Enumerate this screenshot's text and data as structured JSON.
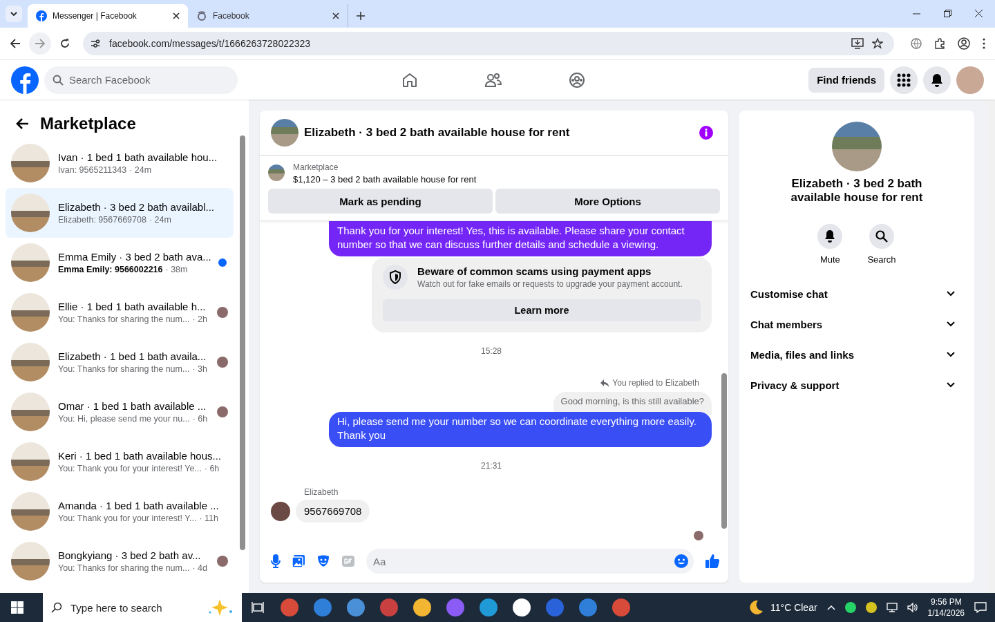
{
  "browser": {
    "tabs": [
      {
        "title": "Messenger | Facebook",
        "selected": true,
        "kind": "facebook"
      },
      {
        "title": "Facebook",
        "selected": false,
        "kind": "other"
      }
    ],
    "url": "facebook.com/messages/t/1666263728022323"
  },
  "header": {
    "search": {
      "placeholder": "Search Facebook"
    },
    "nav": [
      {
        "kind": "home"
      },
      {
        "kind": "friends"
      },
      {
        "kind": "groups"
      }
    ],
    "find_friends": "Find friends"
  },
  "sidebar": {
    "title": "Marketplace",
    "conversations": [
      {
        "title": "Ivan · 1 bed 1 bath available hou...",
        "preview": "Ivan: 9565211343",
        "time": "· 24m",
        "unread": false,
        "selected": false,
        "kind": "plain"
      },
      {
        "title": "Elizabeth · 3 bed 2 bath availabl...",
        "preview": "Elizabeth: 9567669708",
        "time": "· 24m",
        "unread": false,
        "selected": true,
        "kind": "plain"
      },
      {
        "title": "Emma Emily · 3 bed 2 bath ava...",
        "preview": "Emma Emily: 9566002216",
        "time": "· 38m",
        "unread": true,
        "selected": false,
        "kind": "dot"
      },
      {
        "title": "Ellie · 1 bed 1 bath available h...",
        "preview": "You: Thanks for sharing the num...",
        "time": "· 2h",
        "unread": false,
        "selected": false,
        "kind": "seen"
      },
      {
        "title": "Elizabeth · 1 bed 1 bath availa...",
        "preview": "You: Thanks for sharing the num...",
        "time": "· 3h",
        "unread": false,
        "selected": false,
        "kind": "seen"
      },
      {
        "title": "Omar · 1 bed 1 bath available ...",
        "preview": "You: Hi, please send me your nu...",
        "time": "· 6h",
        "unread": false,
        "selected": false,
        "kind": "seen"
      },
      {
        "title": "Keri · 1 bed 1 bath available hous...",
        "preview": "You: Thank you for your interest! Ye...",
        "time": "· 6h",
        "unread": false,
        "selected": false,
        "kind": "plain"
      },
      {
        "title": "Amanda · 1 bed 1 bath available ...",
        "preview": "You: Thank you for your interest! Y...",
        "time": "· 11h",
        "unread": false,
        "selected": false,
        "kind": "plain"
      },
      {
        "title": "Bongkyiang · 3 bed 2 bath av...",
        "preview": "You: Thanks for sharing the num...",
        "time": "· 4d",
        "unread": false,
        "selected": false,
        "kind": "seen"
      }
    ]
  },
  "chat": {
    "title": "Elizabeth · 3 bed 2 bath available house for rent",
    "listing": {
      "label": "Marketplace",
      "text": "$1,120 – 3 bed 2 bath available house for rent",
      "buttons": [
        "Mark as pending",
        "More Options"
      ]
    },
    "messages": [
      {
        "kind": "outgoing",
        "text": "Thank you for your interest! Yes, this is available. Please share your contact number so that we can discuss further details and schedule a viewing.",
        "color": "#7426f6"
      },
      {
        "kind": "notice",
        "title": "Beware of common scams using payment apps",
        "text": "Watch out for fake emails or requests to upgrade your payment account.",
        "button": "Learn more"
      },
      {
        "kind": "time",
        "text": "15:28"
      },
      {
        "kind": "reply-label",
        "text": "You replied to Elizabeth"
      },
      {
        "kind": "quote",
        "text": "Good morning, is this still available?"
      },
      {
        "kind": "outgoing",
        "text": "Hi, please send me your number so we can coordinate everything more easily. Thank you",
        "color": "#3a4ef6"
      },
      {
        "kind": "time",
        "text": "21:31"
      },
      {
        "kind": "incoming",
        "sender": "Elizabeth",
        "text": "9567669708"
      },
      {
        "kind": "seen"
      }
    ],
    "composer": {
      "placeholder": "Aa"
    }
  },
  "details": {
    "title": "Elizabeth · 3 bed 2 bath available house for rent",
    "actions": [
      {
        "label": "Mute",
        "kind": "bell"
      },
      {
        "label": "Search",
        "kind": "search"
      }
    ],
    "sections": [
      {
        "label": "Customise chat",
        "expanded": false
      },
      {
        "label": "Chat members",
        "expanded": false
      },
      {
        "label": "Media, files and links",
        "expanded": false
      },
      {
        "label": "Privacy & support",
        "expanded": false
      }
    ]
  },
  "taskbar": {
    "search": {
      "placeholder": "Type here to search"
    },
    "weather": "11°C Clear",
    "time": "9:56 PM",
    "date": "1/14/2026"
  }
}
